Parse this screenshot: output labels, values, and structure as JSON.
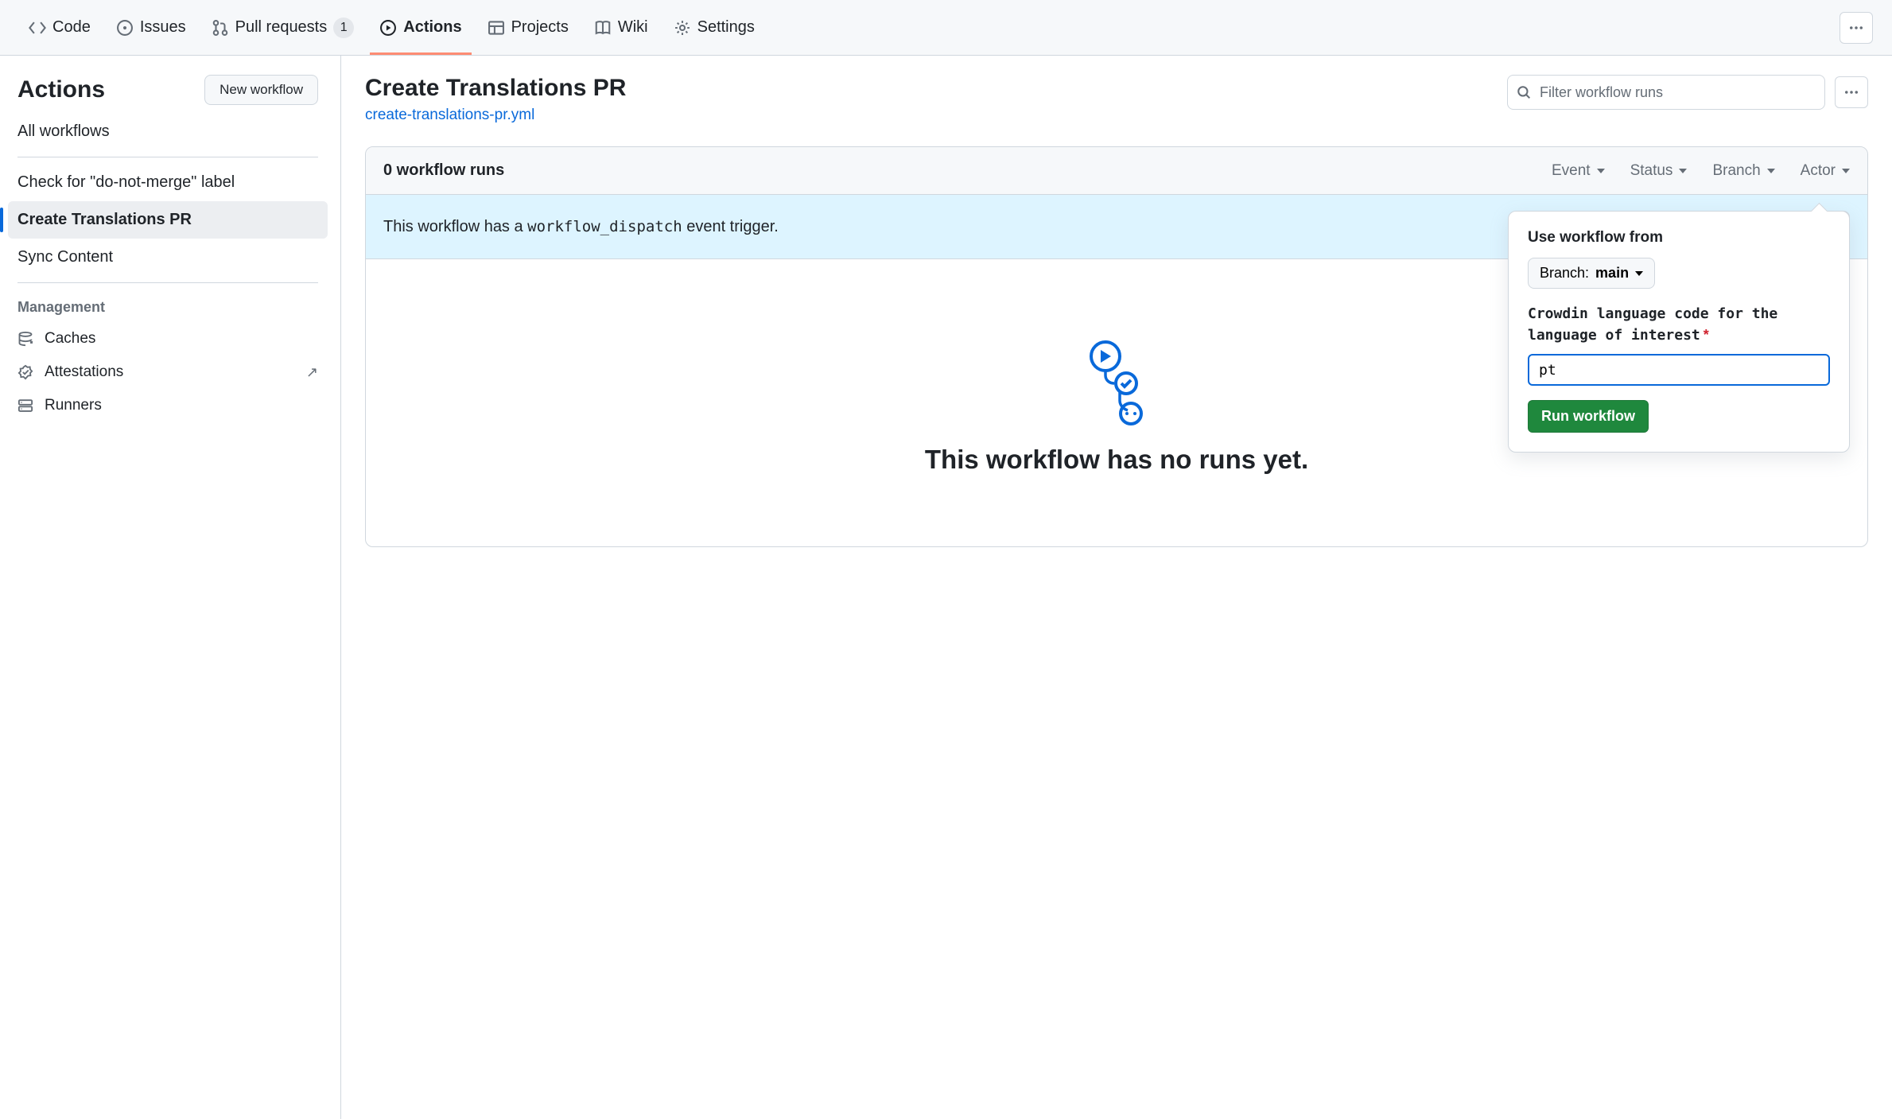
{
  "nav": {
    "code": "Code",
    "issues": "Issues",
    "pulls": "Pull requests",
    "pulls_count": "1",
    "actions": "Actions",
    "projects": "Projects",
    "wiki": "Wiki",
    "settings": "Settings"
  },
  "sidebar": {
    "title": "Actions",
    "new_workflow": "New workflow",
    "all_label": "All workflows",
    "items": [
      {
        "label": "Check for \"do-not-merge\" label"
      },
      {
        "label": "Create Translations PR"
      },
      {
        "label": "Sync Content"
      }
    ],
    "management_label": "Management",
    "mgmt": {
      "caches": "Caches",
      "attestations": "Attestations",
      "runners": "Runners"
    }
  },
  "content": {
    "title": "Create Translations PR",
    "file": "create-translations-pr.yml",
    "search_placeholder": "Filter workflow runs",
    "runs_count": "0 workflow runs",
    "filters": {
      "event": "Event",
      "status": "Status",
      "branch": "Branch",
      "actor": "Actor"
    },
    "dispatch_prefix": "This workflow has a ",
    "dispatch_code": "workflow_dispatch",
    "dispatch_suffix": " event trigger.",
    "run_workflow_btn": "Run workflow",
    "empty_title": "This workflow has no runs yet."
  },
  "popover": {
    "title": "Use workflow from",
    "branch_prefix": "Branch: ",
    "branch_name": "main",
    "field_label": "Crowdin language code for the language of interest",
    "input_value": "pt",
    "submit": "Run workflow"
  }
}
